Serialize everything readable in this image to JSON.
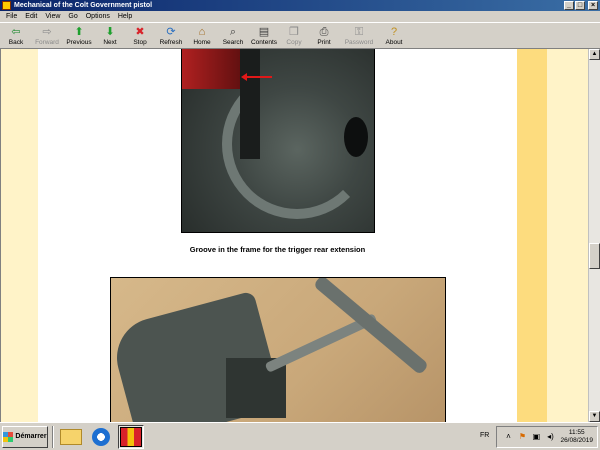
{
  "window": {
    "title": "Mechanical of the Colt Government pistol"
  },
  "menu": [
    "File",
    "Edit",
    "View",
    "Go",
    "Options",
    "Help"
  ],
  "toolbar": [
    {
      "label": "Back",
      "icon": "back-arrow-icon",
      "glyph": "⇦",
      "color": "#1e8a2e",
      "enabled": true,
      "width": 30
    },
    {
      "label": "Forward",
      "icon": "forward-arrow-icon",
      "glyph": "⇨",
      "color": "#8a8a8a",
      "enabled": false,
      "width": 32
    },
    {
      "label": "Previous",
      "icon": "up-arrow-icon",
      "glyph": "⬆",
      "color": "#1ea02e",
      "enabled": true,
      "width": 32
    },
    {
      "label": "Next",
      "icon": "down-arrow-icon",
      "glyph": "⬇",
      "color": "#1ea02e",
      "enabled": true,
      "width": 30
    },
    {
      "label": "Stop",
      "icon": "stop-icon",
      "glyph": "✖",
      "color": "#d8232a",
      "enabled": true,
      "width": 30
    },
    {
      "label": "Refresh",
      "icon": "refresh-icon",
      "glyph": "⟳",
      "color": "#2a6fc0",
      "enabled": true,
      "width": 32
    },
    {
      "label": "Home",
      "icon": "home-icon",
      "glyph": "⌂",
      "color": "#a06a20",
      "enabled": true,
      "width": 30
    },
    {
      "label": "Search",
      "icon": "search-icon",
      "glyph": "⌕",
      "color": "#404040",
      "enabled": true,
      "width": 32
    },
    {
      "label": "Contents",
      "icon": "contents-icon",
      "glyph": "▤",
      "color": "#404040",
      "enabled": true,
      "width": 30
    },
    {
      "label": "Copy",
      "icon": "copy-icon",
      "glyph": "❐",
      "color": "#8a8a8a",
      "enabled": false,
      "width": 30
    },
    {
      "label": "Print",
      "icon": "print-icon",
      "glyph": "⎙",
      "color": "#404040",
      "enabled": true,
      "width": 30
    },
    {
      "label": "Password",
      "icon": "key-icon",
      "glyph": "⚿",
      "color": "#8a8a8a",
      "enabled": false,
      "width": 40
    },
    {
      "label": "About",
      "icon": "about-icon",
      "glyph": "?",
      "color": "#c09020",
      "enabled": true,
      "width": 30
    }
  ],
  "content": {
    "caption": "Groove in the frame for the trigger rear extension"
  },
  "taskbar": {
    "start_label": "Démarrer",
    "language": "FR",
    "time": "11:55",
    "date": "26/08/2019"
  }
}
